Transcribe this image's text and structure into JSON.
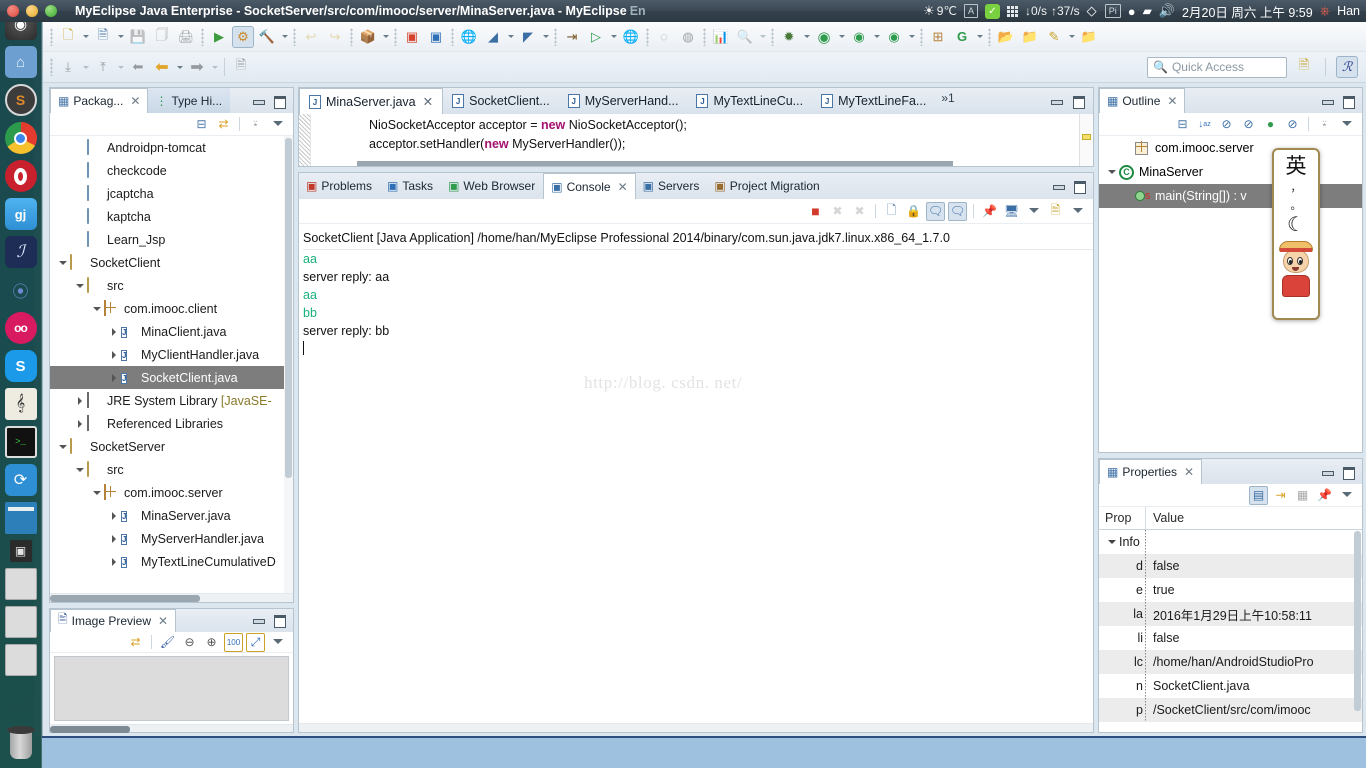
{
  "titlebar": {
    "window_title": "MyEclipse Java Enterprise - SocketServer/src/com/imooc/server/MinaServer.java - MyEclipse ",
    "window_title_tail": "En",
    "buttons": {
      "close": "close",
      "minimize": "minimize",
      "maximize": "maximize"
    },
    "tray": {
      "weather": "9℃",
      "keyboard_layout": "A",
      "net_down": "↓0/s",
      "net_up": "↑37/s",
      "pidgin": "Pi",
      "date": "2月20日 周六 上午 9:59",
      "user": "Han"
    }
  },
  "launcher": {
    "items": [
      {
        "name": "ubuntu-dash",
        "glyph": "◉"
      },
      {
        "name": "files-home",
        "glyph": "⌂"
      },
      {
        "name": "sublime-text",
        "glyph": "S"
      },
      {
        "name": "google-chrome",
        "glyph": "◉"
      },
      {
        "name": "opera",
        "glyph": "O"
      },
      {
        "name": "gj-app",
        "glyph": "gj"
      },
      {
        "name": "blender-or-script",
        "glyph": "ℐ"
      },
      {
        "name": "steam",
        "glyph": "⌄"
      },
      {
        "name": "oo-app",
        "glyph": "oo"
      },
      {
        "name": "skype",
        "glyph": "S"
      },
      {
        "name": "music-player",
        "glyph": "♪"
      },
      {
        "name": "terminal",
        "glyph": ">_"
      },
      {
        "name": "sync-app",
        "glyph": "⟳"
      },
      {
        "name": "text-editor-window",
        "glyph": "▤"
      },
      {
        "name": "workspace-switcher",
        "glyph": "▣"
      },
      {
        "name": "window-1",
        "glyph": "▭"
      },
      {
        "name": "window-2",
        "glyph": "▭"
      },
      {
        "name": "window-3",
        "glyph": "▭"
      },
      {
        "name": "trash",
        "glyph": "🗑"
      }
    ]
  },
  "toolbar_row1": [
    {
      "name": "new-wizard",
      "glyph": "🗋",
      "state": "enabled",
      "caret": true
    },
    {
      "name": "new-java-class",
      "glyph": "🗒",
      "state": "enabled",
      "caret": true
    },
    {
      "name": "save",
      "glyph": "💾",
      "state": "disabled",
      "caret": false
    },
    {
      "name": "save-all",
      "glyph": "🗐",
      "state": "disabled",
      "caret": false
    },
    {
      "name": "print",
      "glyph": "🖨",
      "state": "disabled",
      "caret": false
    },
    {
      "name": "deploy-run",
      "glyph": "▶",
      "state": "enabled",
      "caret": false
    },
    {
      "name": "deploy-myeclipse",
      "glyph": "⚙",
      "state": "selected",
      "caret": false
    },
    {
      "name": "build-hammer",
      "glyph": "🔨",
      "state": "enabled",
      "caret": true
    },
    {
      "name": "undo",
      "glyph": "↩",
      "state": "disabled",
      "caret": false
    },
    {
      "name": "redo",
      "glyph": "↪",
      "state": "disabled",
      "caret": false
    },
    {
      "name": "package-explorer-link",
      "glyph": "📦",
      "state": "enabled",
      "caret": true
    },
    {
      "name": "new-db-red",
      "glyph": "◧",
      "state": "enabled",
      "caret": false
    },
    {
      "name": "new-db-blue",
      "glyph": "◨",
      "state": "enabled",
      "caret": false
    },
    {
      "name": "web-20",
      "glyph": "🌐",
      "state": "enabled",
      "caret": false
    },
    {
      "name": "matisse-designer",
      "glyph": "◮",
      "state": "enabled",
      "caret": true
    },
    {
      "name": "uml-model",
      "glyph": "◭",
      "state": "enabled",
      "caret": true
    },
    {
      "name": "export-jar",
      "glyph": "⇥",
      "state": "enabled",
      "caret": false
    },
    {
      "name": "run-server",
      "glyph": "▷",
      "state": "enabled",
      "caret": true
    },
    {
      "name": "web-browser",
      "glyph": "🌐",
      "state": "enabled",
      "caret": false
    },
    {
      "name": "open-type-dis",
      "glyph": "◌",
      "state": "disabled",
      "caret": false
    },
    {
      "name": "refresh-dis",
      "glyph": "◍",
      "state": "disabled",
      "caret": false
    },
    {
      "name": "report-chart",
      "glyph": "📊",
      "state": "enabled",
      "caret": false
    },
    {
      "name": "search-gray",
      "glyph": "🔍",
      "state": "disabled",
      "caret": true
    },
    {
      "name": "debug",
      "glyph": "🐞",
      "state": "enabled",
      "caret": true
    },
    {
      "name": "run",
      "glyph": "▶",
      "state": "enabled",
      "caret": true
    },
    {
      "name": "run-history",
      "glyph": "⏱",
      "state": "enabled",
      "caret": true
    },
    {
      "name": "external-tools",
      "glyph": "🧰",
      "state": "enabled",
      "caret": true
    },
    {
      "name": "new-package",
      "glyph": "⊞",
      "state": "enabled",
      "caret": false
    },
    {
      "name": "new-gwt",
      "glyph": "G",
      "state": "enabled",
      "caret": true
    },
    {
      "name": "open-resource",
      "glyph": "📂",
      "state": "enabled",
      "caret": false
    },
    {
      "name": "open-folder",
      "glyph": "🗂",
      "state": "enabled",
      "caret": false
    },
    {
      "name": "pencil-edit",
      "glyph": "✎",
      "state": "enabled",
      "caret": true
    },
    {
      "name": "open-package",
      "glyph": "📁",
      "state": "enabled",
      "caret": false
    }
  ],
  "toolbar_row2": [
    {
      "name": "step-into",
      "glyph": "⤓",
      "state": "disabled",
      "caret": true
    },
    {
      "name": "step-return",
      "glyph": "⤒",
      "state": "disabled",
      "caret": true
    },
    {
      "name": "back-history-dis",
      "glyph": "⬅",
      "state": "disabled",
      "caret": false
    },
    {
      "name": "back-navigate",
      "glyph": "⬅",
      "state": "enabled",
      "caret": true
    },
    {
      "name": "forward-navigate",
      "glyph": "➡",
      "state": "disabled",
      "caret": true
    },
    {
      "name": "new-editor",
      "glyph": "🗒",
      "state": "disabled",
      "caret": false
    }
  ],
  "quick_access": {
    "placeholder": "Quick Access",
    "icon": "search-icon",
    "perspective_new": "new-perspective-icon",
    "perspective_myeclipse": "myeclipse-perspective-icon"
  },
  "package_explorer": {
    "tabs": [
      {
        "label": "Packag...",
        "icon": "package-explorer-icon",
        "active": true,
        "closable": true
      },
      {
        "label": "Type Hi...",
        "icon": "type-hierarchy-icon",
        "active": false,
        "closable": false
      }
    ],
    "toolbar": [
      {
        "name": "collapse-all",
        "glyph": "⊟"
      },
      {
        "name": "link-with-editor",
        "glyph": "⇄"
      },
      {
        "name": "view-menu-dots",
        "glyph": "⋰"
      },
      {
        "name": "view-menu",
        "glyph": "▾"
      }
    ],
    "tree": [
      {
        "label": "Androidpn-tomcat",
        "indent": 1,
        "icon": "folder",
        "twisty": "none"
      },
      {
        "label": "checkcode",
        "indent": 1,
        "icon": "folder",
        "twisty": "none"
      },
      {
        "label": "jcaptcha",
        "indent": 1,
        "icon": "folder",
        "twisty": "none"
      },
      {
        "label": "kaptcha",
        "indent": 1,
        "icon": "folder",
        "twisty": "none"
      },
      {
        "label": "Learn_Jsp",
        "indent": 1,
        "icon": "folder",
        "twisty": "none"
      },
      {
        "label": "SocketClient",
        "indent": 0,
        "icon": "project",
        "twisty": "open"
      },
      {
        "label": "src",
        "indent": 1,
        "icon": "source-folder",
        "twisty": "open"
      },
      {
        "label": "com.imooc.client",
        "indent": 2,
        "icon": "package",
        "twisty": "open"
      },
      {
        "label": "MinaClient.java",
        "indent": 3,
        "icon": "java-file",
        "twisty": "closed"
      },
      {
        "label": "MyClientHandler.java",
        "indent": 3,
        "icon": "java-file",
        "twisty": "closed"
      },
      {
        "label": "SocketClient.java",
        "indent": 3,
        "icon": "java-file",
        "twisty": "closed",
        "selected": true
      },
      {
        "label": "JRE System Library [JavaSE-",
        "indent": 1,
        "icon": "library",
        "twisty": "closed"
      },
      {
        "label": "Referenced Libraries",
        "indent": 1,
        "icon": "library",
        "twisty": "closed"
      },
      {
        "label": "SocketServer",
        "indent": 0,
        "icon": "project",
        "twisty": "open"
      },
      {
        "label": "src",
        "indent": 1,
        "icon": "source-folder",
        "twisty": "open"
      },
      {
        "label": "com.imooc.server",
        "indent": 2,
        "icon": "package",
        "twisty": "open"
      },
      {
        "label": "MinaServer.java",
        "indent": 3,
        "icon": "java-file",
        "twisty": "closed"
      },
      {
        "label": "MyServerHandler.java",
        "indent": 3,
        "icon": "java-file",
        "twisty": "closed"
      },
      {
        "label": "MyTextLineCumulativeD",
        "indent": 3,
        "icon": "java-file",
        "twisty": "closed"
      }
    ]
  },
  "image_preview": {
    "tab_label": "Image Preview",
    "tab_icon": "image-preview-icon",
    "toolbar": [
      {
        "name": "link-with-editor",
        "glyph": "⇄"
      },
      {
        "name": "palette",
        "glyph": "🎨"
      },
      {
        "name": "zoom-out",
        "glyph": "⊖"
      },
      {
        "name": "zoom-in",
        "glyph": "⊕"
      },
      {
        "name": "zoom-100",
        "glyph": "100"
      },
      {
        "name": "fit-to-window",
        "glyph": "⤢"
      },
      {
        "name": "view-menu",
        "glyph": "▾"
      }
    ]
  },
  "editor": {
    "tabs": [
      {
        "label": "MinaServer.java",
        "icon": "java-warning-icon",
        "active": true,
        "closable": true
      },
      {
        "label": "SocketClient...",
        "icon": "java-icon",
        "active": false,
        "closable": false
      },
      {
        "label": "MyServerHand...",
        "icon": "java-icon",
        "active": false,
        "closable": false
      },
      {
        "label": "MyTextLineCu...",
        "icon": "java-icon",
        "active": false,
        "closable": false
      },
      {
        "label": "MyTextLineFa...",
        "icon": "java-icon",
        "active": false,
        "closable": false
      }
    ],
    "more_tabs": "»1",
    "code_lines": [
      {
        "segments": [
          {
            "t": "NioSocketAcceptor acceptor = ",
            "k": false
          },
          {
            "t": "new",
            "k": true
          },
          {
            "t": " NioSocketAcceptor();",
            "k": false
          }
        ]
      },
      {
        "segments": [
          {
            "t": "acceptor.setHandler(",
            "k": false
          },
          {
            "t": "new",
            "k": true
          },
          {
            "t": " MyServerHandler());",
            "k": false
          }
        ]
      }
    ]
  },
  "bottom_panel": {
    "tabs": [
      {
        "label": "Problems",
        "icon": "problems-icon",
        "active": false,
        "closable": false
      },
      {
        "label": "Tasks",
        "icon": "tasks-icon",
        "active": false,
        "closable": false
      },
      {
        "label": "Web Browser",
        "icon": "web-browser-icon",
        "active": false,
        "closable": false
      },
      {
        "label": "Console",
        "icon": "console-icon",
        "active": true,
        "closable": true
      },
      {
        "label": "Servers",
        "icon": "servers-icon",
        "active": false,
        "closable": false
      },
      {
        "label": "Project Migration",
        "icon": "project-migration-icon",
        "active": false,
        "closable": false
      }
    ],
    "toolbar": [
      {
        "name": "terminate-button",
        "glyph": "■",
        "state": "enabled"
      },
      {
        "name": "remove-launch",
        "glyph": "✖",
        "state": "disabled"
      },
      {
        "name": "remove-all-launches",
        "glyph": "✖",
        "state": "disabled"
      },
      {
        "name": "clear-console",
        "glyph": "🗋",
        "state": "enabled"
      },
      {
        "name": "scroll-lock",
        "glyph": "🔒",
        "state": "enabled"
      },
      {
        "name": "show-console-on-output",
        "glyph": "🗨",
        "state": "selected"
      },
      {
        "name": "show-console-on-error",
        "glyph": "🗨",
        "state": "selected"
      },
      {
        "name": "pin-console",
        "glyph": "📌",
        "state": "enabled"
      },
      {
        "name": "display-selected-console",
        "glyph": "🖥",
        "state": "enabled",
        "caret": true
      },
      {
        "name": "open-console",
        "glyph": "🗒",
        "state": "enabled",
        "caret": true
      }
    ],
    "console": {
      "header": "SocketClient [Java Application] /home/han/MyEclipse Professional 2014/binary/com.sun.java.jdk7.linux.x86_64_1.7.0",
      "lines": [
        {
          "text": "aa",
          "color": "green"
        },
        {
          "text": "server reply: aa",
          "color": "black"
        },
        {
          "text": "aa",
          "color": "green"
        },
        {
          "text": "bb",
          "color": "green"
        },
        {
          "text": "server reply: bb",
          "color": "black"
        }
      ],
      "watermark": "http://blog. csdn. net/"
    }
  },
  "outline": {
    "tab_label": "Outline",
    "tab_icon": "outline-icon",
    "toolbar": [
      {
        "name": "collapse-all",
        "glyph": "⊟"
      },
      {
        "name": "sort-alphabetically",
        "glyph": "↓ᴬz"
      },
      {
        "name": "hide-non-public",
        "glyph": "⊘"
      },
      {
        "name": "hide-static-fields",
        "glyph": "⊘ˢ"
      },
      {
        "name": "hide-fields",
        "glyph": "●"
      },
      {
        "name": "hide-local-types",
        "glyph": "⊘ᴸ"
      },
      {
        "name": "view-menu-dots",
        "glyph": "⋰"
      },
      {
        "name": "view-menu",
        "glyph": "▾"
      }
    ],
    "tree": [
      {
        "label": "com.imooc.server",
        "indent": 1,
        "icon": "package",
        "twisty": "none"
      },
      {
        "label": "MinaServer",
        "indent": 0,
        "icon": "class",
        "twisty": "open"
      },
      {
        "label": "main(String[]) : v",
        "indent": 1,
        "icon": "method-static",
        "twisty": "none",
        "selected": true
      }
    ]
  },
  "properties": {
    "tab_label": "Properties",
    "tab_icon": "properties-icon",
    "toolbar": [
      {
        "name": "show-categories",
        "glyph": "▤",
        "state": "selected"
      },
      {
        "name": "show-advanced",
        "glyph": "⇥",
        "state": "enabled"
      },
      {
        "name": "restore-default",
        "glyph": "▦",
        "state": "disabled"
      },
      {
        "name": "pin-to-selection",
        "glyph": "📌",
        "state": "enabled"
      },
      {
        "name": "view-menu",
        "glyph": "▾"
      }
    ],
    "columns": [
      "Prop",
      "Value"
    ],
    "rows": [
      {
        "name": "Info",
        "value": "",
        "group": true
      },
      {
        "name": "d",
        "value": "false"
      },
      {
        "name": "e",
        "value": "true"
      },
      {
        "name": "la",
        "value": "2016年1月29日上午10:58:11"
      },
      {
        "name": "li",
        "value": "false"
      },
      {
        "name": "lc",
        "value": "/home/han/AndroidStudioPro"
      },
      {
        "name": "n",
        "value": "SocketClient.java"
      },
      {
        "name": "p",
        "value": "/SocketClient/src/com/imooc"
      }
    ]
  },
  "ime": {
    "mode": "英",
    "comma": "，",
    "dot": "。",
    "moon": "☾",
    "character": "luffy-avatar"
  }
}
